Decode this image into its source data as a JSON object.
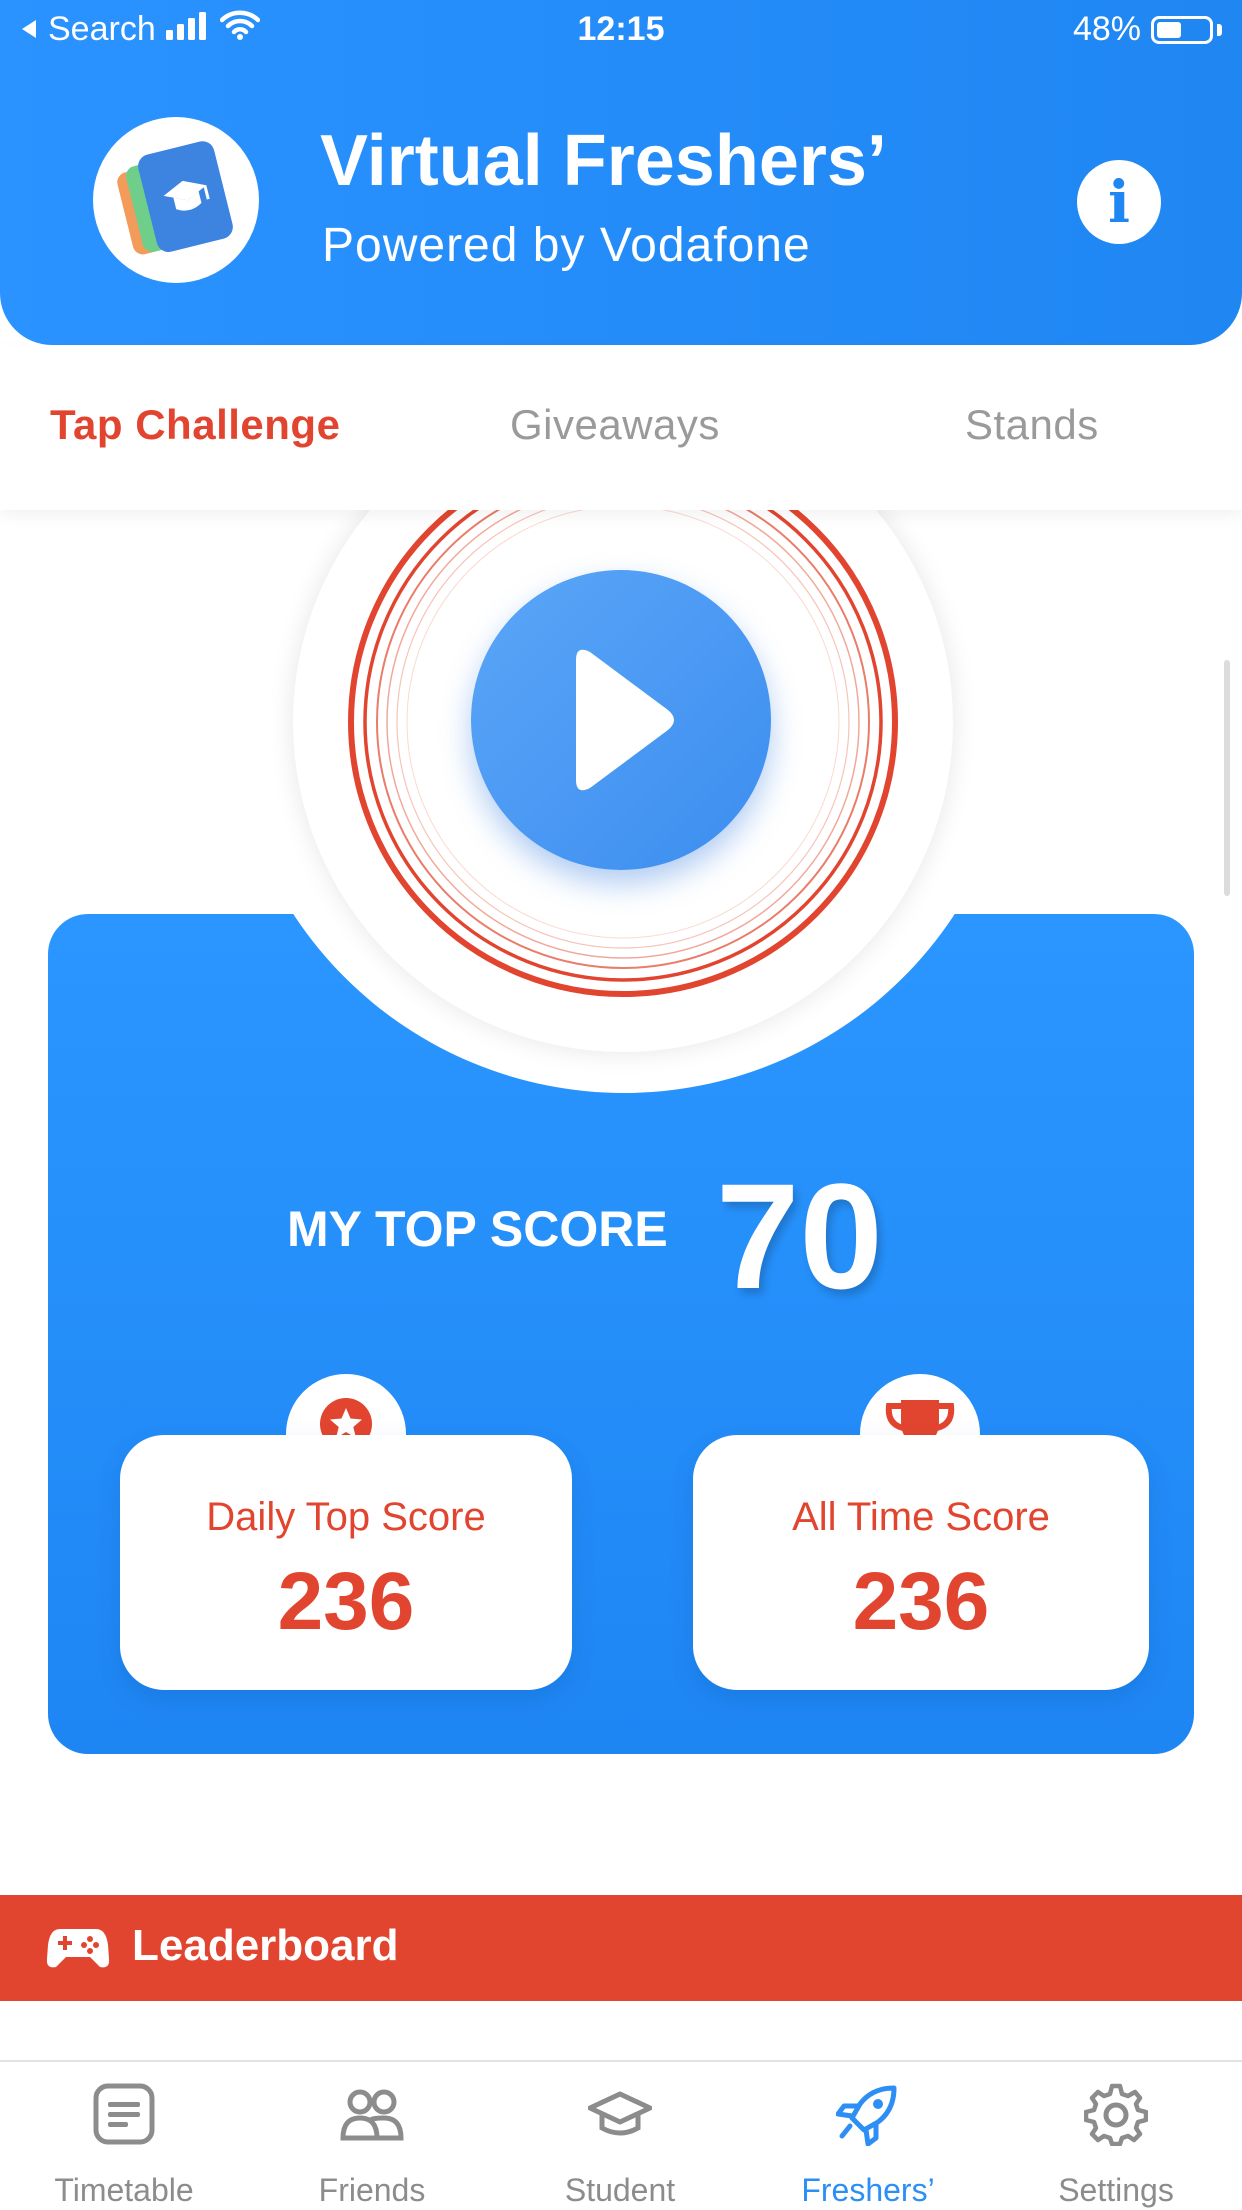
{
  "status_bar": {
    "back_label": "Search",
    "time": "12:15",
    "battery": "48%",
    "battery_level": 0.48
  },
  "header": {
    "title": "Virtual Freshers’",
    "subtitle": "Powered by Vodafone",
    "info_icon": "info-icon",
    "info_glyph": "i"
  },
  "tabs": [
    {
      "label": "Tap Challenge",
      "active": true
    },
    {
      "label": "Giveaways",
      "active": false
    },
    {
      "label": "Stands",
      "active": false
    }
  ],
  "game": {
    "play_icon": "play-icon",
    "top_score_label": "MY TOP SCORE",
    "top_score_value": "70",
    "stats": [
      {
        "label": "Daily Top Score",
        "value": "236",
        "icon": "award-ribbon-icon"
      },
      {
        "label": "All Time Score",
        "value": "236",
        "icon": "trophy-icon"
      }
    ]
  },
  "leaderboard": {
    "label": "Leaderboard",
    "icon": "gamepad-icon"
  },
  "bottom_nav": [
    {
      "label": "Timetable",
      "icon": "timetable-icon",
      "active": false
    },
    {
      "label": "Friends",
      "icon": "friends-icon",
      "active": false
    },
    {
      "label": "Student",
      "icon": "graduation-cap-icon",
      "active": false
    },
    {
      "label": "Freshers’",
      "icon": "rocket-icon",
      "active": true
    },
    {
      "label": "Settings",
      "icon": "gear-icon",
      "active": false
    }
  ],
  "colors": {
    "primary_blue": "#1f86f2",
    "accent_red": "#e2452f",
    "inactive_gray": "#8c8c8c"
  }
}
